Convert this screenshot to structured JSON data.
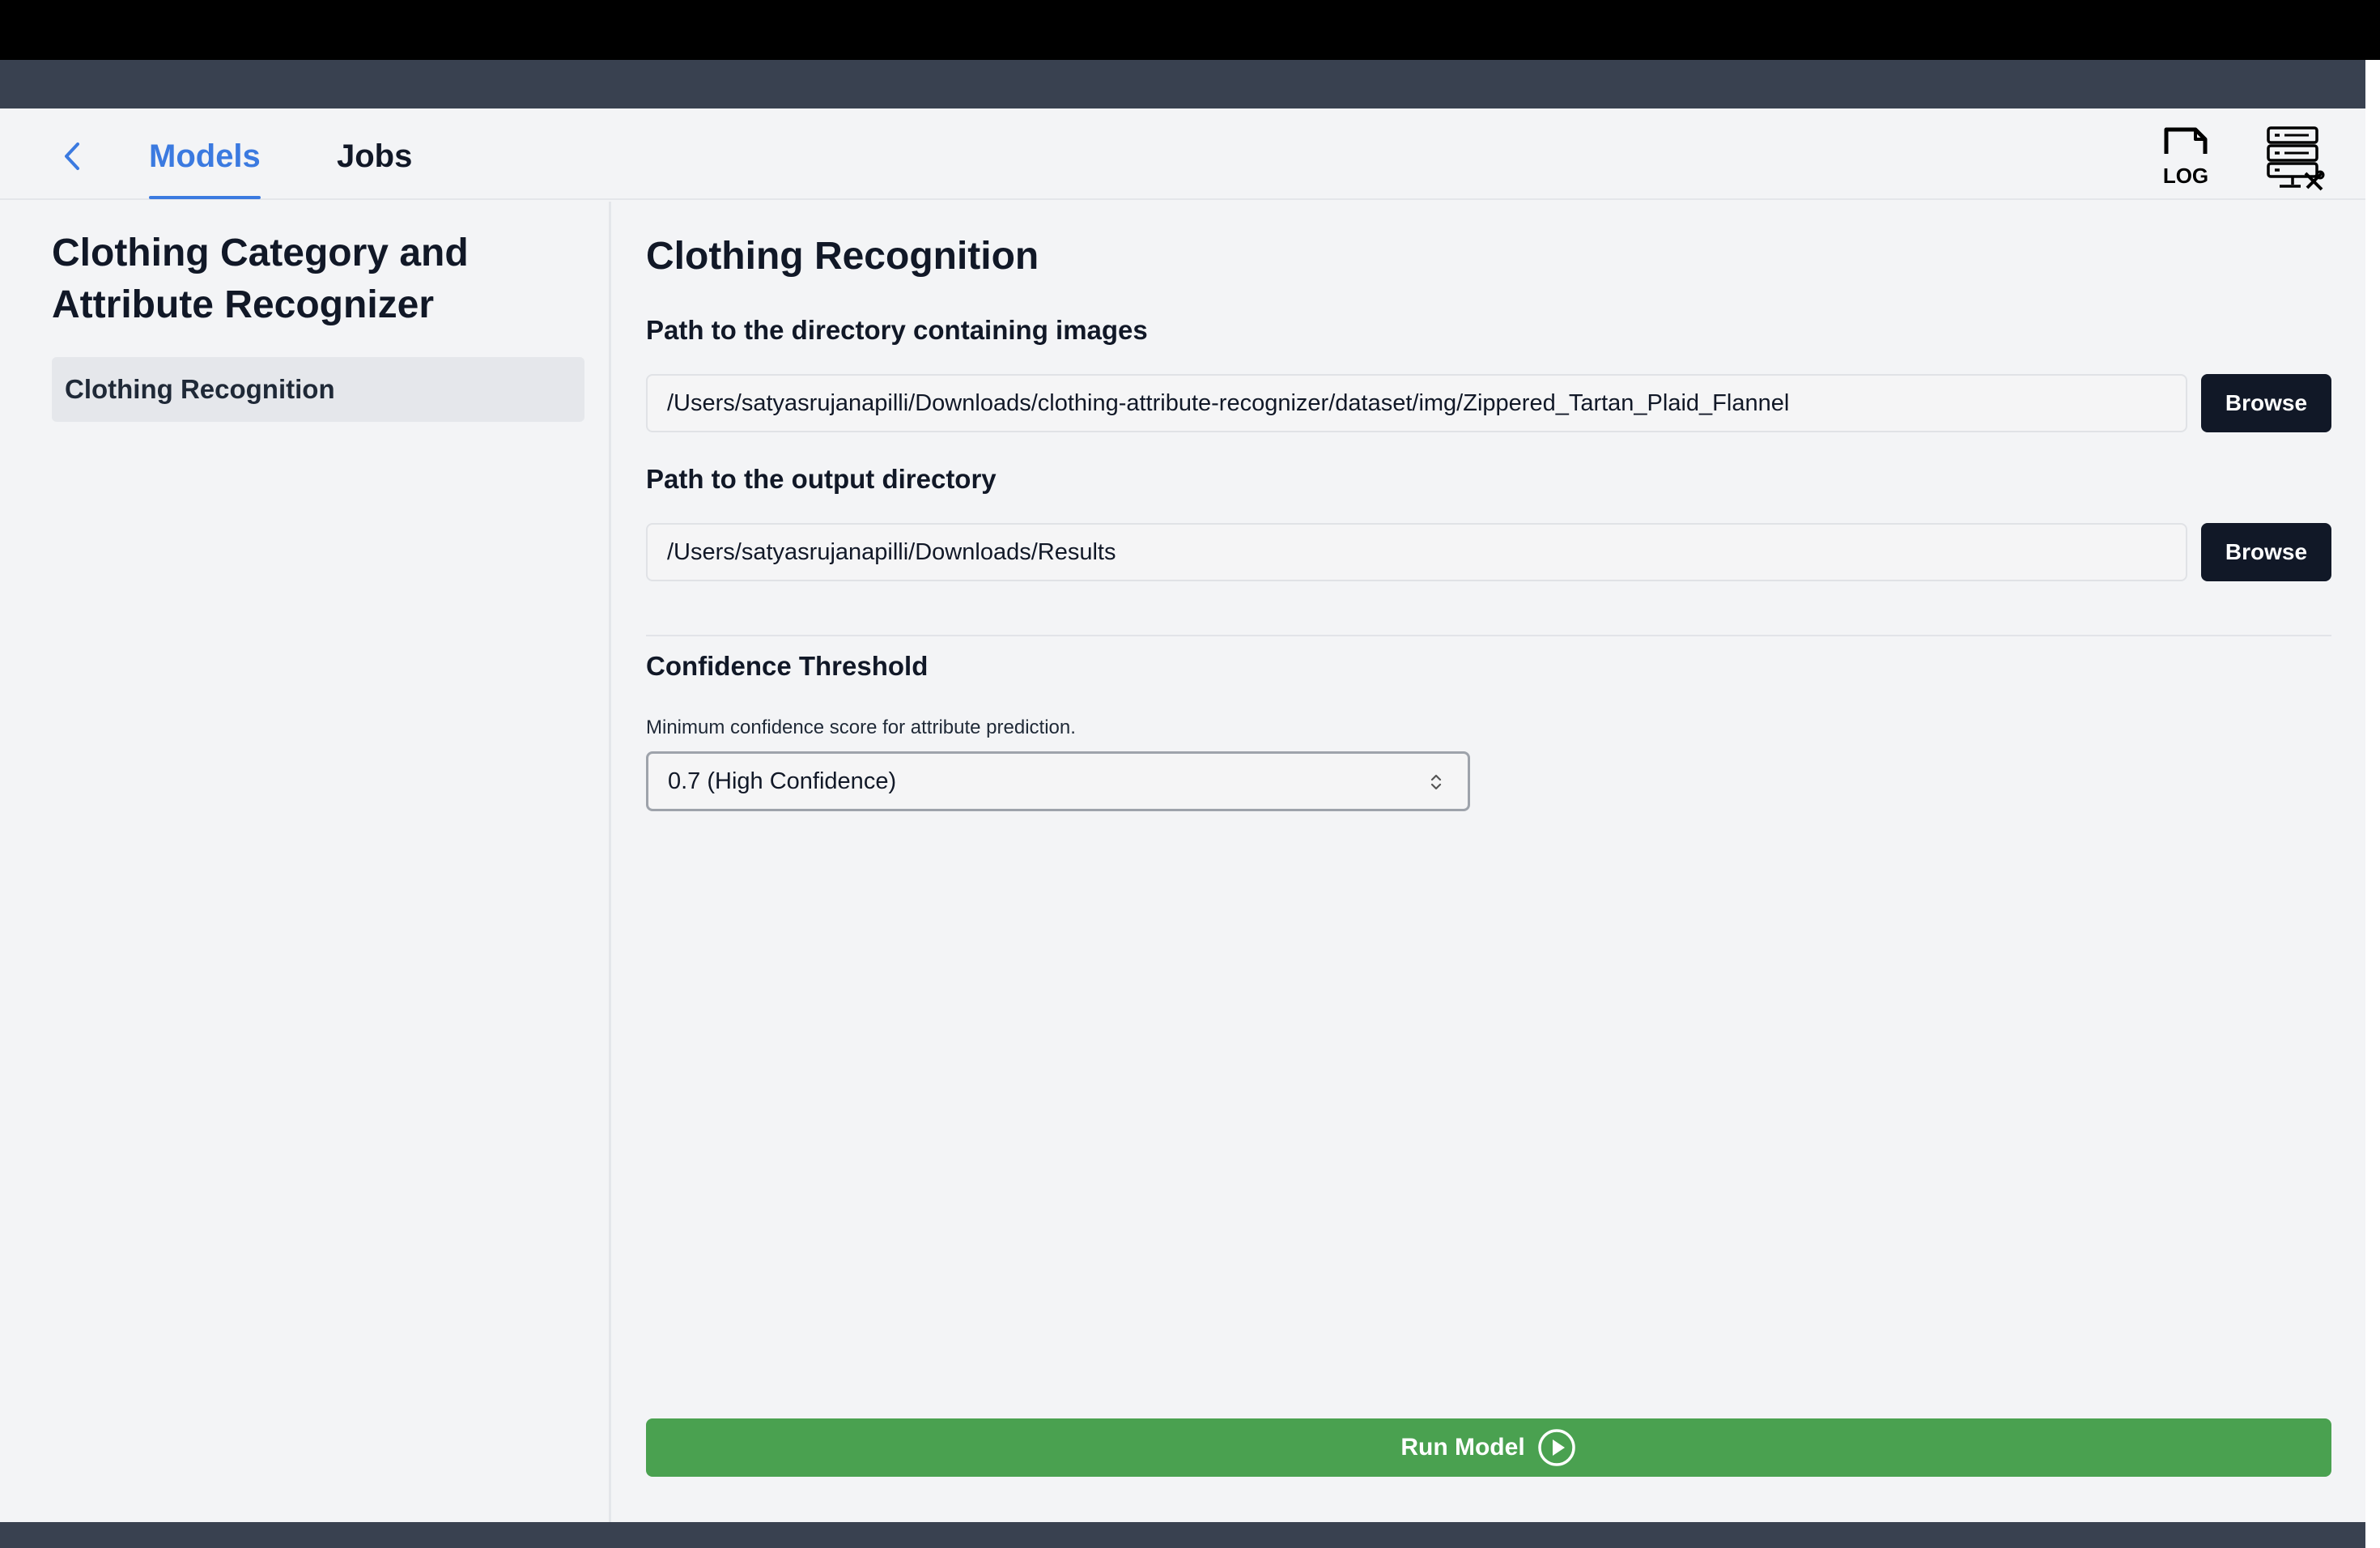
{
  "header": {
    "tabs": [
      {
        "label": "Models",
        "active": true
      },
      {
        "label": "Jobs",
        "active": false
      }
    ],
    "log_icon_text": "LOG"
  },
  "sidebar": {
    "title": "Clothing Category and Attribute Recognizer",
    "items": [
      {
        "label": "Clothing Recognition",
        "selected": true
      }
    ]
  },
  "main": {
    "title": "Clothing Recognition",
    "input_dir": {
      "label": "Path to the directory containing images",
      "value": "/Users/satyasrujanapilli/Downloads/clothing-attribute-recognizer/dataset/img/Zippered_Tartan_Plaid_Flannel",
      "browse_label": "Browse"
    },
    "output_dir": {
      "label": "Path to the output directory",
      "value": "/Users/satyasrujanapilli/Downloads/Results",
      "browse_label": "Browse"
    },
    "confidence": {
      "label": "Confidence Threshold",
      "help": "Minimum confidence score for attribute prediction.",
      "selected": "0.7 (High Confidence)"
    },
    "run_label": "Run Model"
  },
  "colors": {
    "accent": "#3b7ae0",
    "run_button": "#4aa150",
    "dark_button": "#111827",
    "frame_band": "#394150"
  },
  "icons": {
    "back": "chevron-left-icon",
    "log": "log-file-icon",
    "server": "server-settings-icon",
    "select": "chevron-up-down-icon",
    "run": "play-circle-icon"
  }
}
